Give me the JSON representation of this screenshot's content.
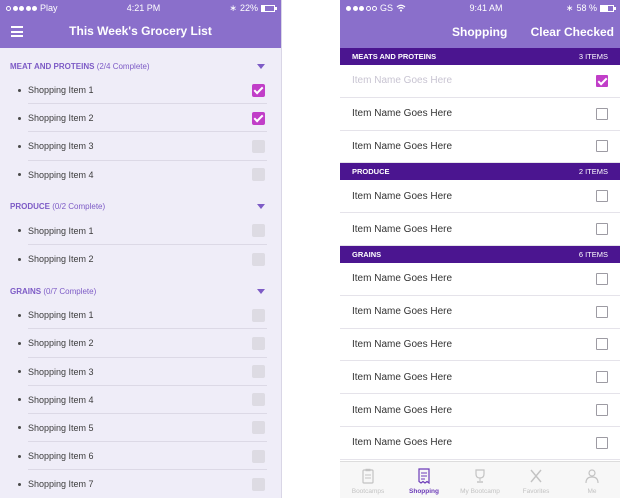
{
  "left_screen": {
    "status": {
      "carrier": "Play",
      "time": "4:21 PM",
      "battery": "22%",
      "battery_level": 0.22
    },
    "title": "This Week's Grocery List",
    "menu_icon": "hamburger-icon",
    "sections": [
      {
        "name": "MEAT AND PROTEINS",
        "progress": "(2/4 Complete)",
        "items": [
          {
            "label": "Shopping Item 1",
            "checked": true
          },
          {
            "label": "Shopping Item 2",
            "checked": true
          },
          {
            "label": "Shopping Item 3",
            "checked": false
          },
          {
            "label": "Shopping Item 4",
            "checked": false
          }
        ]
      },
      {
        "name": "PRODUCE",
        "progress": "(0/2 Complete)",
        "items": [
          {
            "label": "Shopping Item 1",
            "checked": false
          },
          {
            "label": "Shopping Item 2",
            "checked": false
          }
        ]
      },
      {
        "name": "GRAINS",
        "progress": "(0/7 Complete)",
        "items": [
          {
            "label": "Shopping Item 1",
            "checked": false
          },
          {
            "label": "Shopping Item 2",
            "checked": false
          },
          {
            "label": "Shopping Item 3",
            "checked": false
          },
          {
            "label": "Shopping Item 4",
            "checked": false
          },
          {
            "label": "Shopping Item 5",
            "checked": false
          },
          {
            "label": "Shopping Item 6",
            "checked": false
          },
          {
            "label": "Shopping Item 7",
            "checked": false
          }
        ]
      }
    ]
  },
  "right_screen": {
    "status": {
      "carrier": "GS",
      "time": "9:41 AM",
      "battery": "58 %",
      "battery_level": 0.58
    },
    "title": "Shopping",
    "clear_label": "Clear Checked",
    "categories": [
      {
        "name": "MEATS AND PROTEINS",
        "count": "3 ITEMS",
        "items": [
          {
            "label": "Item Name Goes Here",
            "checked": true
          },
          {
            "label": "Item Name Goes Here",
            "checked": false
          },
          {
            "label": "Item Name Goes Here",
            "checked": false
          }
        ]
      },
      {
        "name": "PRODUCE",
        "count": "2 ITEMS",
        "items": [
          {
            "label": "Item Name Goes Here",
            "checked": false
          },
          {
            "label": "Item Name Goes Here",
            "checked": false
          }
        ]
      },
      {
        "name": "GRAINS",
        "count": "6 ITEMS",
        "items": [
          {
            "label": "Item Name Goes Here",
            "checked": false
          },
          {
            "label": "Item Name Goes Here",
            "checked": false
          },
          {
            "label": "Item Name Goes Here",
            "checked": false
          },
          {
            "label": "Item Name Goes Here",
            "checked": false
          },
          {
            "label": "Item Name Goes Here",
            "checked": false
          },
          {
            "label": "Item Name Goes Here",
            "checked": false
          }
        ]
      }
    ],
    "tabs": [
      {
        "label": "Bootcamps",
        "icon": "clipboard-icon",
        "active": false
      },
      {
        "label": "Shopping",
        "icon": "receipt-icon",
        "active": true
      },
      {
        "label": "My Bootcamp",
        "icon": "trophy-icon",
        "active": false
      },
      {
        "label": "Favorites",
        "icon": "utensils-icon",
        "active": false
      },
      {
        "label": "Me",
        "icon": "person-icon",
        "active": false
      }
    ]
  },
  "colors": {
    "header": "#8a6fcb",
    "category_bar": "#4b1590",
    "accent": "#7d5bc6",
    "check": "#c13ec8",
    "tab_active": "#6c3bb8"
  }
}
